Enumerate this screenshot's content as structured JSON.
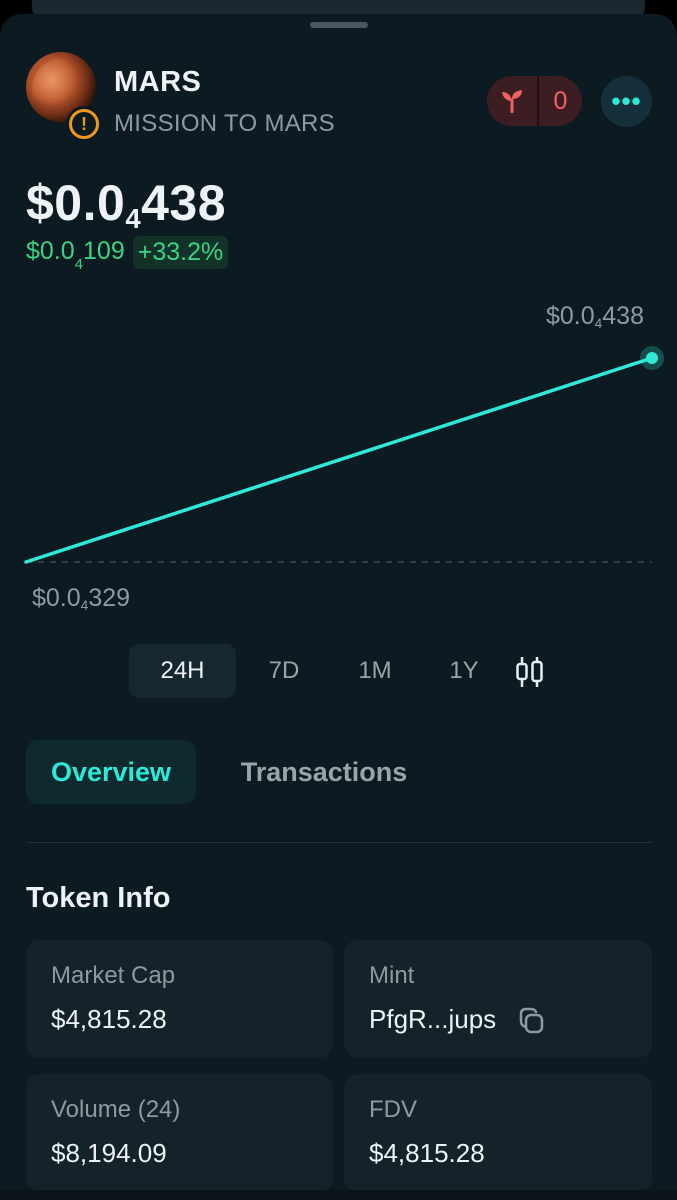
{
  "header": {
    "token_symbol": "MARS",
    "token_name": "MISSION TO MARS",
    "reaction_count": "0",
    "more_icon": "ellipsis-icon",
    "warning_icon": "exclamation-icon"
  },
  "price": {
    "prefix": "$0.0",
    "zero_count": "4",
    "digits": "438"
  },
  "change": {
    "abs_prefix": "$0.0",
    "abs_zero_count": "4",
    "abs_digits": "109",
    "percent": "+33.2%",
    "color": "#39d482"
  },
  "chart_data": {
    "type": "line",
    "x": [
      "start",
      "end"
    ],
    "series": [
      {
        "values": [
          3.29e-05,
          4.38e-05
        ]
      }
    ],
    "high_label": {
      "prefix": "$0.0",
      "zero_count": "4",
      "digits": "438"
    },
    "low_label": {
      "prefix": "$0.0",
      "zero_count": "4",
      "digits": "329"
    },
    "line_color": "#2ee8d8",
    "baseline": "dashed"
  },
  "ranges": [
    "24H",
    "7D",
    "1M",
    "1Y"
  ],
  "active_range": "24H",
  "tabs": {
    "overview": "Overview",
    "transactions": "Transactions"
  },
  "token_info": {
    "title": "Token Info",
    "market_cap_label": "Market Cap",
    "market_cap_value": "$4,815.28",
    "mint_label": "Mint",
    "mint_value": "PfgR...jups",
    "volume_label": "Volume (24)",
    "volume_value": "$8,194.09",
    "fdv_label": "FDV",
    "fdv_value": "$4,815.28"
  },
  "colors": {
    "accent": "#2ee8d8",
    "positive": "#39d482",
    "warning": "#f09a1c",
    "reaction": "#f06262"
  }
}
